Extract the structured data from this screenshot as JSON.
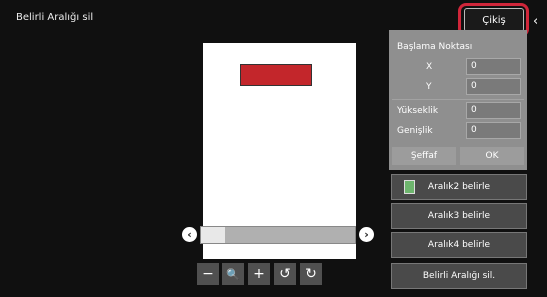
{
  "header": {
    "title": "Belirli Aralığı sil",
    "exit_label": "Çikiş"
  },
  "panel": {
    "title": "Başlama Noktası",
    "x_label": "X",
    "x_value": "0",
    "y_label": "Y",
    "y_value": "0",
    "height_label": "Yükseklik",
    "height_value": "0",
    "width_label": "Genişlik",
    "width_value": "0",
    "transparent_label": "Şeffaf",
    "ok_label": "OK"
  },
  "actions": {
    "range2": "Aralık2 belirle",
    "range3": "Aralık3 belirle",
    "range4": "Aralık4 belirle",
    "delete_range": "Belirli Aralığı sil."
  },
  "toolbar": {
    "zoom_out_glyph": "−",
    "zoom_glyph": "🔍",
    "zoom_in_glyph": "+",
    "rotate_left_glyph": "↺",
    "rotate_right_glyph": "↻"
  },
  "nav": {
    "left_glyph": "‹",
    "right_glyph": "›",
    "collapse_glyph": "‹"
  },
  "colors": {
    "highlight": "#d0263a",
    "selection": "#c3262b"
  }
}
